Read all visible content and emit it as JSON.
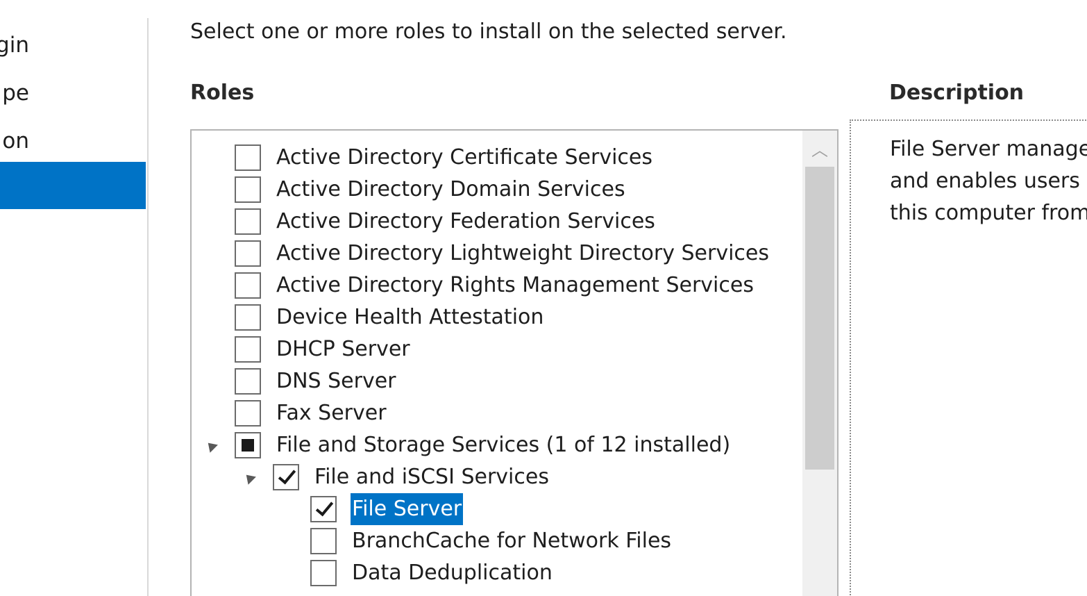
{
  "nav": {
    "items": [
      {
        "label": "gin"
      },
      {
        "label": "pe"
      },
      {
        "label": "on"
      },
      {
        "label": "",
        "active": true
      }
    ]
  },
  "instruction": "Select one or more roles to install on the selected server.",
  "roles_title": "Roles",
  "description_title": "Description",
  "description_text": "File Server manage\nand enables users t\nthis computer from",
  "roles": [
    {
      "label": "Active Directory Certificate Services",
      "state": "unchecked",
      "level": 0
    },
    {
      "label": "Active Directory Domain Services",
      "state": "unchecked",
      "level": 0
    },
    {
      "label": "Active Directory Federation Services",
      "state": "unchecked",
      "level": 0
    },
    {
      "label": "Active Directory Lightweight Directory Services",
      "state": "unchecked",
      "level": 0
    },
    {
      "label": "Active Directory Rights Management Services",
      "state": "unchecked",
      "level": 0
    },
    {
      "label": "Device Health Attestation",
      "state": "unchecked",
      "level": 0
    },
    {
      "label": "DHCP Server",
      "state": "unchecked",
      "level": 0
    },
    {
      "label": "DNS Server",
      "state": "unchecked",
      "level": 0
    },
    {
      "label": "Fax Server",
      "state": "unchecked",
      "level": 0
    },
    {
      "label": "File and Storage Services (1 of 12 installed)",
      "state": "partial",
      "level": 0,
      "expanded": true
    },
    {
      "label": "File and iSCSI Services",
      "state": "checked",
      "level": 1,
      "expanded": true
    },
    {
      "label": "File Server",
      "state": "checked",
      "level": 2,
      "selected": true
    },
    {
      "label": "BranchCache for Network Files",
      "state": "unchecked",
      "level": 2
    },
    {
      "label": "Data Deduplication",
      "state": "unchecked",
      "level": 2
    }
  ],
  "scrollbar": {
    "up_glyph": "︿"
  }
}
